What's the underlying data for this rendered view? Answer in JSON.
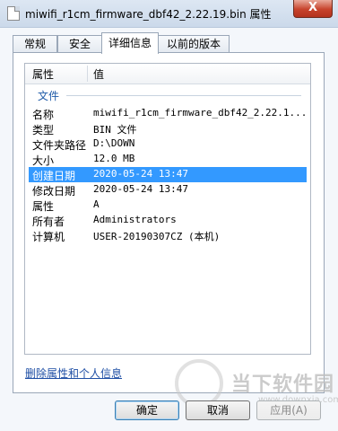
{
  "window": {
    "title": "miwifi_r1cm_firmware_dbf42_2.22.19.bin 属性",
    "close": "X"
  },
  "tabs": [
    {
      "label": "常规"
    },
    {
      "label": "安全"
    },
    {
      "label": "详细信息",
      "active": true
    },
    {
      "label": "以前的版本"
    }
  ],
  "table": {
    "headers": [
      "属性",
      "值"
    ],
    "group": "文件",
    "rows": [
      {
        "key": "名称",
        "value": "miwifi_r1cm_firmware_dbf42_2.22.1..."
      },
      {
        "key": "类型",
        "value": "BIN 文件"
      },
      {
        "key": "文件夹路径",
        "value": "D:\\DOWN"
      },
      {
        "key": "大小",
        "value": "12.0 MB"
      },
      {
        "key": "创建日期",
        "value": "2020-05-24 13:47",
        "selected": true
      },
      {
        "key": "修改日期",
        "value": "2020-05-24 13:47"
      },
      {
        "key": "属性",
        "value": "A"
      },
      {
        "key": "所有者",
        "value": "Administrators"
      },
      {
        "key": "计算机",
        "value": "USER-20190307CZ (本机)"
      }
    ]
  },
  "link": "删除属性和个人信息",
  "buttons": {
    "ok": "确定",
    "cancel": "取消",
    "apply": "应用(A)"
  },
  "watermark": {
    "text": "当下软件园",
    "sub": "www.downxia.com"
  }
}
